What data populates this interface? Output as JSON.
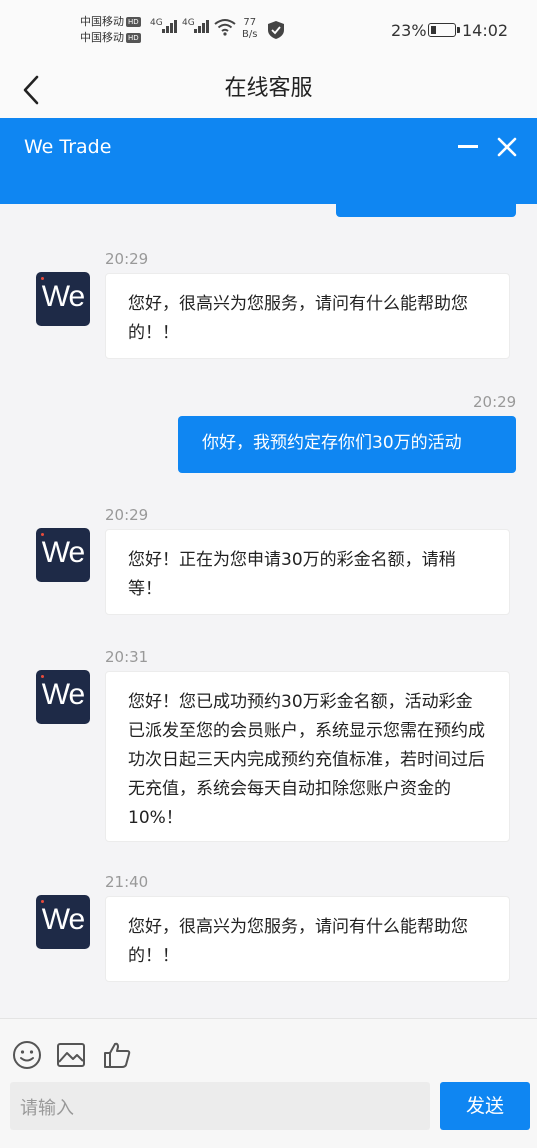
{
  "status_bar": {
    "carrier1": "中国移动",
    "carrier2": "中国移动",
    "hd": "HD",
    "net1": "4G",
    "net2": "4G",
    "speed_value": "77",
    "speed_unit": "B/s",
    "battery_percent": "23%",
    "battery_level": 0.23,
    "time": "14:02"
  },
  "nav": {
    "title": "在线客服"
  },
  "banner": {
    "title": "We Trade"
  },
  "avatar": {
    "text": "We"
  },
  "messages": [
    {
      "time": "20:29",
      "text": "您好，很高兴为您服务，请问有什么能帮助您的！！"
    },
    {
      "time": "20:29",
      "text": "你好，我预约定存你们30万的活动"
    },
    {
      "time": "20:29",
      "text": "您好！正在为您申请30万的彩金名额，请稍等！"
    },
    {
      "time": "20:31",
      "text": "您好！您已成功预约30万彩金名额，活动彩金已派发至您的会员账户，系统显示您需在预约成功次日起三天内完成预约充值标准，若时间过后无充值，系统会每天自动扣除您账户资金的10%！"
    },
    {
      "time": "21:40",
      "text": "您好，很高兴为您服务，请问有什么能帮助您的！！"
    }
  ],
  "composer": {
    "placeholder": "请输入",
    "send_label": "发送"
  },
  "icons": {
    "emoji": "smiley-icon",
    "image": "image-icon",
    "like": "thumbs-up-icon"
  },
  "colors": {
    "accent": "#0f86f2",
    "avatar_bg": "#1e2a47"
  }
}
